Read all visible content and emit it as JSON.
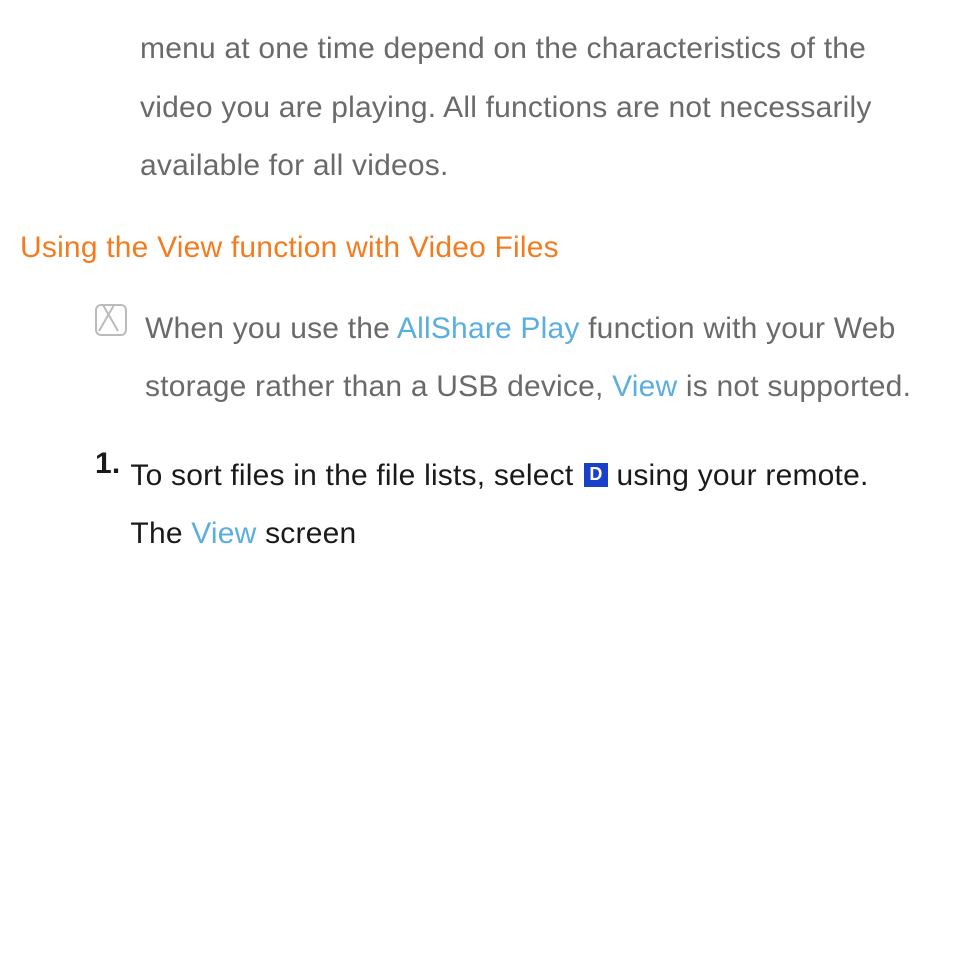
{
  "intro": {
    "text": "menu at one time depend on the characteristics of the video you are playing. All functions are not necessarily available for all videos."
  },
  "heading": {
    "text": "Using the View function with Video Files"
  },
  "note": {
    "part1": "When you use the ",
    "highlight1": "AllShare Play",
    "part2": " function with your Web storage rather than a USB device, ",
    "highlight2": "View",
    "part3": " is not supported."
  },
  "step1": {
    "number": "1.",
    "part1": "To sort files in the file lists, select ",
    "button": "D",
    "part2": " using your remote. The ",
    "highlight1": "View",
    "part3": " screen"
  }
}
